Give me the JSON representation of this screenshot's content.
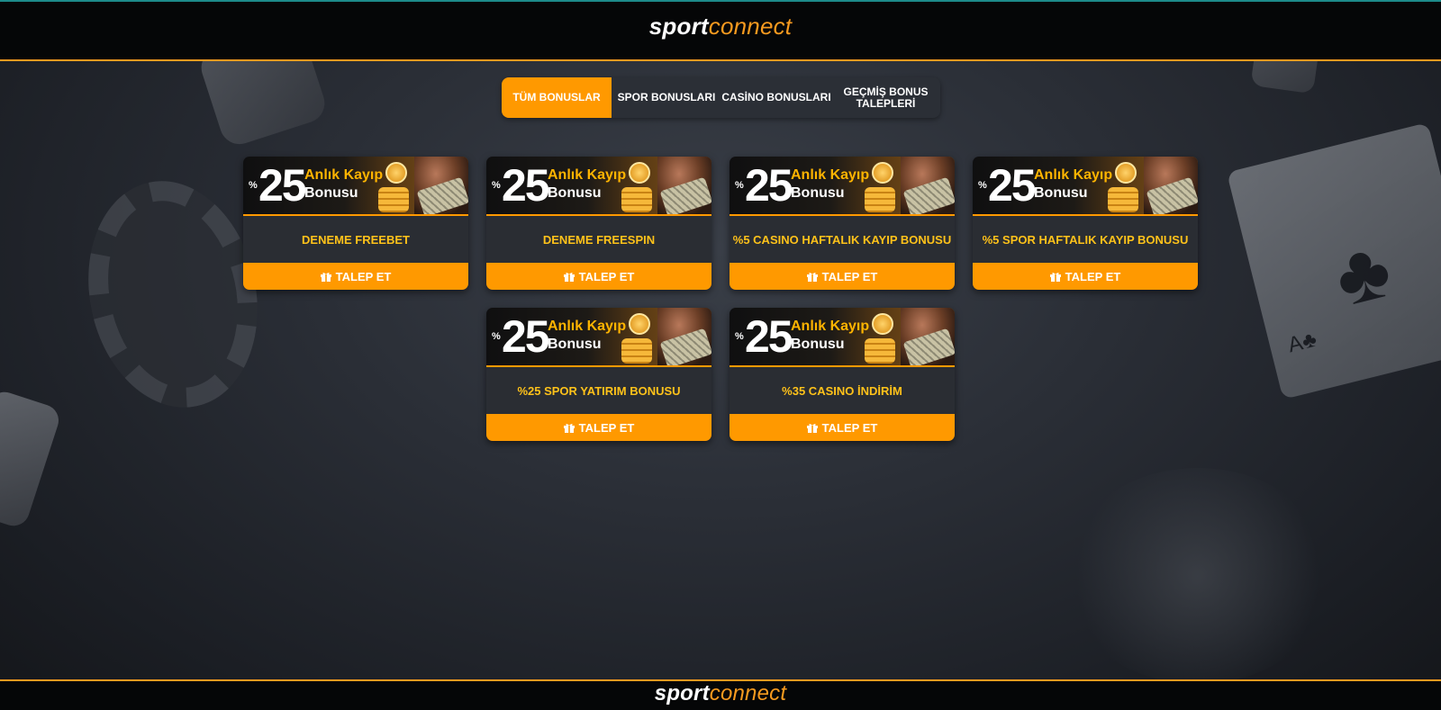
{
  "header": {
    "logo_bold": "sport",
    "logo_light": "connect"
  },
  "tabs": [
    {
      "label": "TÜM BONUSLAR",
      "active": true
    },
    {
      "label": "SPOR BONUSLARI",
      "active": false
    },
    {
      "label": "CASİNO BONUSLARI",
      "active": false
    },
    {
      "label": "GEÇMİŞ BONUS\nTALEPLERİ",
      "active": false
    }
  ],
  "banner": {
    "percent_sign": "%",
    "number": "25",
    "line1": "Anlık Kayıp",
    "line2": "Bonusu"
  },
  "cards": [
    {
      "title": "DENEME FREEBET",
      "button": "TALEP ET"
    },
    {
      "title": "DENEME FREESPIN",
      "button": "TALEP ET"
    },
    {
      "title": "%5 CASINO HAFTALIK KAYIP BONUSU",
      "button": "TALEP ET"
    },
    {
      "title": "%5 SPOR HAFTALIK KAYIP BONUSU",
      "button": "TALEP ET"
    },
    {
      "title": "%25 SPOR YATIRIM BONUSU",
      "button": "TALEP ET"
    },
    {
      "title": "%35 CASINO İNDİRİM",
      "button": "TALEP ET"
    }
  ],
  "footer": {
    "logo_bold": "sport",
    "logo_light": "connect"
  },
  "colors": {
    "accent": "#ff9900",
    "title_yellow": "#ffc21a",
    "header_bg": "#050607",
    "teal_border": "#1d8a8a"
  }
}
